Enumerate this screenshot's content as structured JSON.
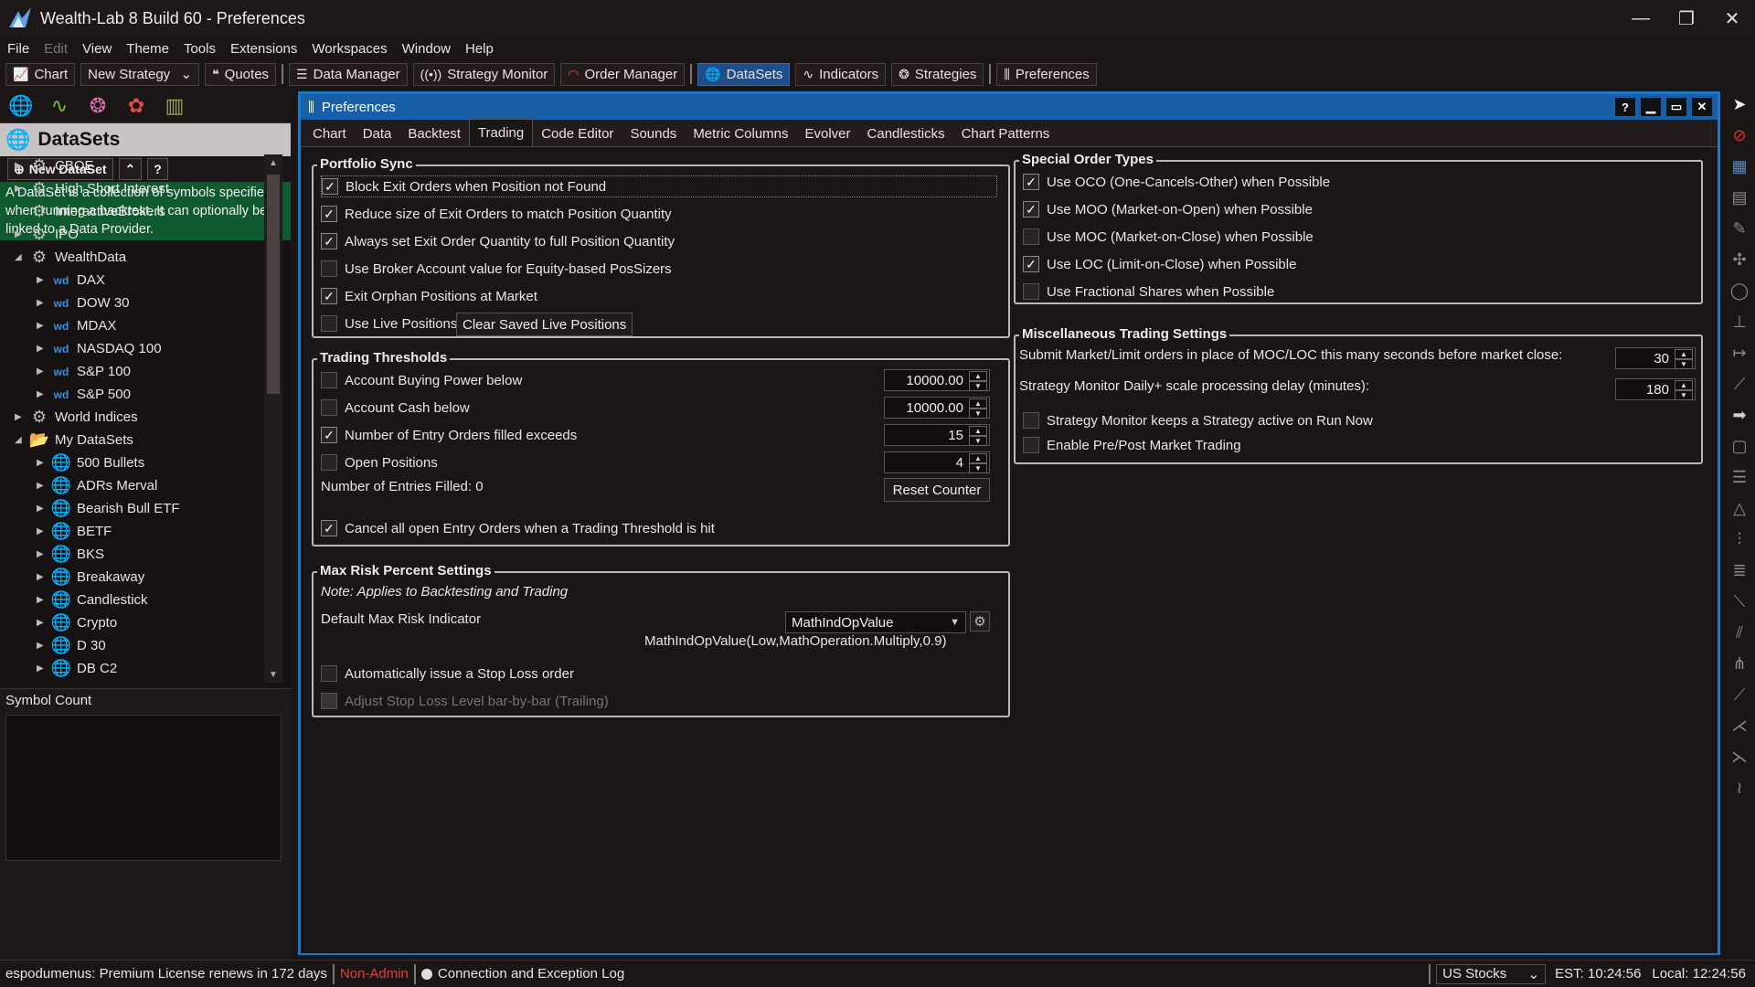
{
  "window": {
    "title": "Wealth-Lab 8 Build 60 - Preferences",
    "controls": {
      "minimize": "—",
      "restore": "❐",
      "close": "✕"
    }
  },
  "menu": [
    "File",
    "Edit",
    "View",
    "Theme",
    "Tools",
    "Extensions",
    "Workspaces",
    "Window",
    "Help"
  ],
  "toolbar": {
    "chart": "Chart",
    "strategy_select": "New Strategy",
    "quotes": "Quotes",
    "data_manager": "Data Manager",
    "strategy_monitor": "Strategy Monitor",
    "order_manager": "Order Manager",
    "datasets": "DataSets",
    "indicators": "Indicators",
    "strategies": "Strategies",
    "preferences": "Preferences"
  },
  "left_panel": {
    "title": "DataSets",
    "new_dataset": "New DataSet",
    "description": "A DataSet is a collection of symbols specified when running a backtest. It can optionally be linked to a Data Provider.",
    "tree": [
      {
        "label": "CBOE",
        "level": 0,
        "icon": "gear-icon",
        "arrow": "▶"
      },
      {
        "label": "High Short Interest",
        "level": 0,
        "icon": "gear-icon",
        "arrow": "▶"
      },
      {
        "label": "InteractiveBrokers",
        "level": 0,
        "icon": "gear-icon",
        "arrow": ""
      },
      {
        "label": "IPO",
        "level": 0,
        "icon": "gear-icon",
        "arrow": "▶"
      },
      {
        "label": "WealthData",
        "level": 0,
        "icon": "gear-icon",
        "arrow": "◢"
      },
      {
        "label": "DAX",
        "level": 1,
        "icon": "wealthdata-icon",
        "arrow": "▶"
      },
      {
        "label": "DOW 30",
        "level": 1,
        "icon": "wealthdata-icon",
        "arrow": "▶"
      },
      {
        "label": "MDAX",
        "level": 1,
        "icon": "wealthdata-icon",
        "arrow": "▶"
      },
      {
        "label": "NASDAQ 100",
        "level": 1,
        "icon": "wealthdata-icon",
        "arrow": "▶"
      },
      {
        "label": "S&P 100",
        "level": 1,
        "icon": "wealthdata-icon",
        "arrow": "▶"
      },
      {
        "label": "S&P 500",
        "level": 1,
        "icon": "wealthdata-icon",
        "arrow": "▶"
      },
      {
        "label": "World Indices",
        "level": 0,
        "icon": "gear-icon",
        "arrow": "▶"
      },
      {
        "label": "My DataSets",
        "level": 0,
        "icon": "folder-icon",
        "arrow": "◢"
      },
      {
        "label": "500 Bullets",
        "level": 1,
        "icon": "globe-icon",
        "arrow": "▶"
      },
      {
        "label": "ADRs Merval",
        "level": 1,
        "icon": "globe-icon",
        "arrow": "▶"
      },
      {
        "label": "Bearish Bull ETF",
        "level": 1,
        "icon": "globe-icon",
        "arrow": "▶"
      },
      {
        "label": "BETF",
        "level": 1,
        "icon": "globe-icon",
        "arrow": "▶"
      },
      {
        "label": "BKS",
        "level": 1,
        "icon": "globe-icon",
        "arrow": "▶"
      },
      {
        "label": "Breakaway",
        "level": 1,
        "icon": "globe-icon",
        "arrow": "▶"
      },
      {
        "label": "Candlestick",
        "level": 1,
        "icon": "globe-icon",
        "arrow": "▶"
      },
      {
        "label": "Crypto",
        "level": 1,
        "icon": "globe-icon",
        "arrow": "▶"
      },
      {
        "label": "D 30",
        "level": 1,
        "icon": "globe-icon",
        "arrow": "▶"
      },
      {
        "label": "DB C2",
        "level": 1,
        "icon": "globe-icon",
        "arrow": "▶"
      }
    ],
    "symbol_count_label": "Symbol Count"
  },
  "prefs": {
    "title": "Preferences",
    "tabs": [
      "Chart",
      "Data",
      "Backtest",
      "Trading",
      "Code Editor",
      "Sounds",
      "Metric Columns",
      "Evolver",
      "Candlesticks",
      "Chart Patterns"
    ],
    "active_tab": "Trading",
    "portfolio_sync": {
      "title": "Portfolio Sync",
      "items": [
        {
          "label": "Block Exit Orders when Position not Found",
          "checked": true
        },
        {
          "label": "Reduce size of Exit Orders to match Position Quantity",
          "checked": true
        },
        {
          "label": "Always set Exit Order Quantity to full Position Quantity",
          "checked": true
        },
        {
          "label": "Use Broker Account value for Equity-based PosSizers",
          "checked": false
        },
        {
          "label": "Exit Orphan Positions at Market",
          "checked": true
        },
        {
          "label": "Use Live Positions",
          "checked": false
        }
      ],
      "clear_button": "Clear Saved Live Positions"
    },
    "trading_thresholds": {
      "title": "Trading Thresholds",
      "items": [
        {
          "label": "Account Buying Power below",
          "checked": false,
          "value": "10000.00"
        },
        {
          "label": "Account Cash below",
          "checked": false,
          "value": "10000.00"
        },
        {
          "label": "Number of Entry Orders filled exceeds",
          "checked": true,
          "value": "15"
        },
        {
          "label": "Open Positions",
          "checked": false,
          "value": "4"
        }
      ],
      "entries_filled": "Number of Entries Filled: 0",
      "reset_button": "Reset Counter",
      "cancel_label": "Cancel all open Entry Orders when a Trading Threshold is hit",
      "cancel_checked": true
    },
    "max_risk": {
      "title": "Max Risk Percent Settings",
      "note": "Note: Applies to Backtesting and Trading",
      "indicator_label": "Default Max Risk Indicator",
      "indicator_value": "MathIndOpValue",
      "indicator_expr": "MathIndOpValue(Low,MathOperation.Multiply,0.9)",
      "auto_stop_label": "Automatically issue a Stop Loss order",
      "auto_stop_checked": false,
      "trailing_label": "Adjust Stop Loss Level bar-by-bar (Trailing)"
    },
    "special_orders": {
      "title": "Special Order Types",
      "items": [
        {
          "label": "Use OCO (One-Cancels-Other) when Possible",
          "checked": true
        },
        {
          "label": "Use MOO (Market-on-Open) when Possible",
          "checked": true
        },
        {
          "label": "Use MOC (Market-on-Close) when Possible",
          "checked": false
        },
        {
          "label": "Use LOC (Limit-on-Close) when Possible",
          "checked": true
        },
        {
          "label": "Use Fractional Shares when Possible",
          "checked": false
        }
      ]
    },
    "misc": {
      "title": "Miscellaneous Trading Settings",
      "submit_label": "Submit Market/Limit orders in place of MOC/LOC this many seconds before market close:",
      "submit_value": "30",
      "delay_label": "Strategy Monitor Daily+ scale processing delay (minutes):",
      "delay_value": "180",
      "keep_active_label": "Strategy Monitor keeps a Strategy active on Run Now",
      "keep_active_checked": false,
      "prepost_label": "Enable Pre/Post Market Trading",
      "prepost_checked": false
    }
  },
  "status": {
    "license": "espodumenus: Premium License renews in 172 days",
    "admin": "Non-Admin",
    "log": "Connection and Exception Log",
    "market": "US Stocks",
    "est": "EST: 10:24:56",
    "local": "Local: 12:24:56"
  }
}
